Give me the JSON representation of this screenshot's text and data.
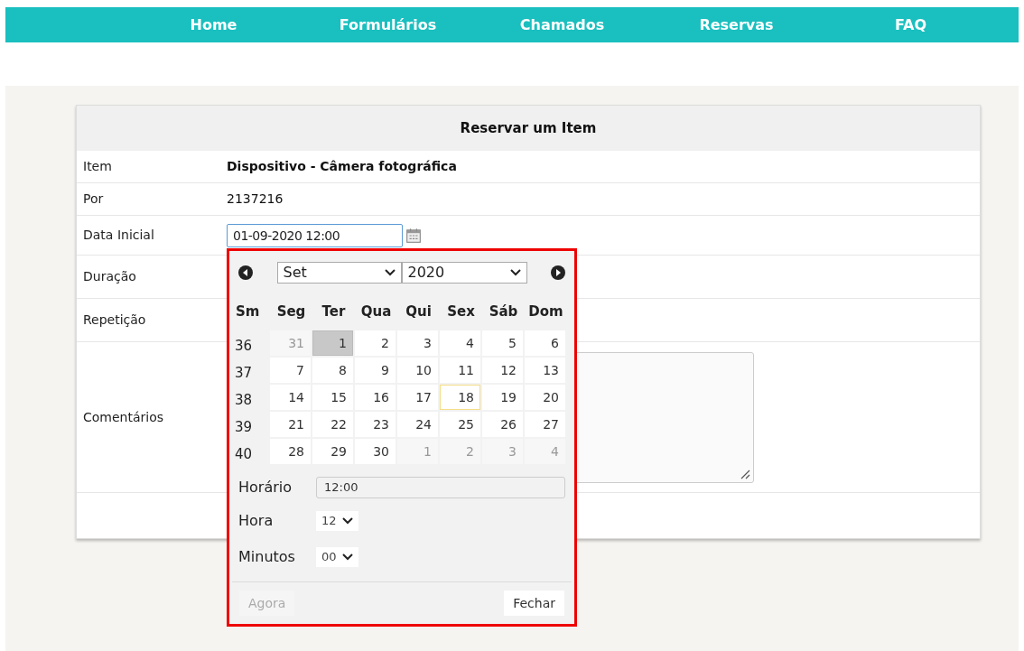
{
  "nav": [
    {
      "label": "Home"
    },
    {
      "label": "Formulários"
    },
    {
      "label": "Chamados"
    },
    {
      "label": "Reservas"
    },
    {
      "label": "FAQ"
    }
  ],
  "form": {
    "title": "Reservar um Item",
    "rows": [
      {
        "label": "Item",
        "value": "Dispositivo - Câmera fotográfica",
        "kind": "bold"
      },
      {
        "label": "Por",
        "value": "2137216",
        "kind": "text"
      },
      {
        "label": "Data Inicial",
        "value": "01-09-2020 12:00",
        "kind": "date"
      },
      {
        "label": "Duração",
        "kind": "empty"
      },
      {
        "label": "Repetição",
        "kind": "empty"
      },
      {
        "label": "Comentários",
        "kind": "textarea"
      }
    ]
  },
  "datepicker": {
    "month": "Set",
    "year": "2020",
    "columns": [
      "Sm",
      "Seg",
      "Ter",
      "Qua",
      "Qui",
      "Sex",
      "Sáb",
      "Dom"
    ],
    "weeks": [
      {
        "number": "36",
        "days": [
          {
            "day": "31",
            "other_month": true,
            "selected": false,
            "today": false
          },
          {
            "day": "1",
            "other_month": false,
            "selected": true,
            "today": false
          },
          {
            "day": "2",
            "other_month": false,
            "selected": false,
            "today": false
          },
          {
            "day": "3",
            "other_month": false,
            "selected": false,
            "today": false
          },
          {
            "day": "4",
            "other_month": false,
            "selected": false,
            "today": false
          },
          {
            "day": "5",
            "other_month": false,
            "selected": false,
            "today": false
          },
          {
            "day": "6",
            "other_month": false,
            "selected": false,
            "today": false
          }
        ]
      },
      {
        "number": "37",
        "days": [
          {
            "day": "7",
            "other_month": false,
            "selected": false,
            "today": false
          },
          {
            "day": "8",
            "other_month": false,
            "selected": false,
            "today": false
          },
          {
            "day": "9",
            "other_month": false,
            "selected": false,
            "today": false
          },
          {
            "day": "10",
            "other_month": false,
            "selected": false,
            "today": false
          },
          {
            "day": "11",
            "other_month": false,
            "selected": false,
            "today": false
          },
          {
            "day": "12",
            "other_month": false,
            "selected": false,
            "today": false
          },
          {
            "day": "13",
            "other_month": false,
            "selected": false,
            "today": false
          }
        ]
      },
      {
        "number": "38",
        "days": [
          {
            "day": "14",
            "other_month": false,
            "selected": false,
            "today": false
          },
          {
            "day": "15",
            "other_month": false,
            "selected": false,
            "today": false
          },
          {
            "day": "16",
            "other_month": false,
            "selected": false,
            "today": false
          },
          {
            "day": "17",
            "other_month": false,
            "selected": false,
            "today": false
          },
          {
            "day": "18",
            "other_month": false,
            "selected": false,
            "today": true
          },
          {
            "day": "19",
            "other_month": false,
            "selected": false,
            "today": false
          },
          {
            "day": "20",
            "other_month": false,
            "selected": false,
            "today": false
          }
        ]
      },
      {
        "number": "39",
        "days": [
          {
            "day": "21",
            "other_month": false,
            "selected": false,
            "today": false
          },
          {
            "day": "22",
            "other_month": false,
            "selected": false,
            "today": false
          },
          {
            "day": "23",
            "other_month": false,
            "selected": false,
            "today": false
          },
          {
            "day": "24",
            "other_month": false,
            "selected": false,
            "today": false
          },
          {
            "day": "25",
            "other_month": false,
            "selected": false,
            "today": false
          },
          {
            "day": "26",
            "other_month": false,
            "selected": false,
            "today": false
          },
          {
            "day": "27",
            "other_month": false,
            "selected": false,
            "today": false
          }
        ]
      },
      {
        "number": "40",
        "days": [
          {
            "day": "28",
            "other_month": false,
            "selected": false,
            "today": false
          },
          {
            "day": "29",
            "other_month": false,
            "selected": false,
            "today": false
          },
          {
            "day": "30",
            "other_month": false,
            "selected": false,
            "today": false
          },
          {
            "day": "1",
            "other_month": true,
            "selected": false,
            "today": false
          },
          {
            "day": "2",
            "other_month": true,
            "selected": false,
            "today": false
          },
          {
            "day": "3",
            "other_month": true,
            "selected": false,
            "today": false
          },
          {
            "day": "4",
            "other_month": true,
            "selected": false,
            "today": false
          }
        ]
      }
    ],
    "time_label": "Horário",
    "time_value": "12:00",
    "hour_label": "Hora",
    "hour": "12",
    "minute_label": "Minutos",
    "minute": "00",
    "now_button": {
      "label": "Agora",
      "disabled": true
    },
    "close_button": {
      "label": "Fechar",
      "disabled": false
    }
  }
}
